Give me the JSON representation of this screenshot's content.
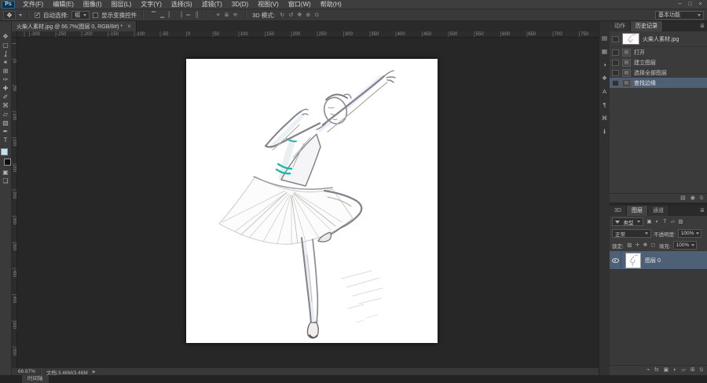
{
  "window": {
    "controls": [
      "─",
      "□",
      "×"
    ]
  },
  "menu_bar": {
    "logo": "Ps",
    "items": [
      "文件(F)",
      "编辑(E)",
      "图像(I)",
      "图层(L)",
      "文字(Y)",
      "选择(S)",
      "滤镜(T)",
      "3D(D)",
      "视图(V)",
      "窗口(W)",
      "帮助(H)"
    ]
  },
  "options_bar": {
    "tool_glyph": "✥",
    "auto_select_label": "自动选择:",
    "auto_select_value": "组",
    "transform_label": "显示变换控件",
    "mode_3d_label": "3D 模式:",
    "align_icons": [
      "▔",
      "▁",
      "▏",
      "▕",
      "═",
      "║"
    ],
    "distribute_icons": [
      "≡",
      "≣",
      "≋"
    ],
    "mode_3d_icons": [
      "↻",
      "↺",
      "✥",
      "⊕",
      "⊙"
    ],
    "workspace": "基本功能"
  },
  "document_tab": {
    "title": "火柴人素材.jpg @ 66.7%(图层 0, RGB/8#) *",
    "close": "×"
  },
  "rulers": {
    "h_labels": [
      "-300",
      "-250",
      "-200",
      "-150",
      "-100",
      "-50",
      "0",
      "50",
      "100",
      "150",
      "200",
      "250",
      "300",
      "350",
      "400",
      "450",
      "500",
      "550",
      "600",
      "650",
      "700",
      "750"
    ],
    "v_labels": [
      "0",
      "50",
      "100",
      "150",
      "200",
      "250",
      "300",
      "350",
      "400",
      "450",
      "500",
      "550"
    ]
  },
  "toolbox": {
    "tools": [
      {
        "n": "move-tool-icon",
        "g": "✥"
      },
      {
        "n": "marquee-tool-icon",
        "g": "▢"
      },
      {
        "n": "lasso-tool-icon",
        "g": "ʆ"
      },
      {
        "n": "quick-selection-tool-icon",
        "g": "✶"
      },
      {
        "n": "crop-tool-icon",
        "g": "⊞"
      },
      {
        "n": "eyedropper-tool-icon",
        "g": "✑"
      },
      {
        "n": "healing-brush-tool-icon",
        "g": "✚"
      },
      {
        "n": "brush-tool-icon",
        "g": "✐"
      },
      {
        "n": "clone-stamp-tool-icon",
        "g": "⌘"
      },
      {
        "n": "eraser-tool-icon",
        "g": "▱"
      },
      {
        "n": "gradient-tool-icon",
        "g": "▨"
      },
      {
        "n": "pen-tool-icon",
        "g": "✒"
      },
      {
        "n": "type-tool-icon",
        "g": "T"
      }
    ],
    "below_swatch_tools": [
      {
        "n": "quick-mask-icon",
        "g": "▣"
      },
      {
        "n": "screen-mode-icon",
        "g": "❏"
      }
    ],
    "foreground_color": "#bfe2f0",
    "background_color": "#0e0e0e"
  },
  "side_strip": [
    {
      "n": "color-panel-icon",
      "g": "▤"
    },
    {
      "n": "swatches-panel-icon",
      "g": "▦"
    },
    {
      "n": "adjustments-panel-icon",
      "g": "◑"
    },
    {
      "n": "styles-panel-icon",
      "g": "❖"
    },
    {
      "n": "character-panel-icon",
      "g": "A"
    },
    {
      "n": "paragraph-panel-icon",
      "g": "¶"
    },
    {
      "n": "clone-source-panel-icon",
      "g": "⌘"
    },
    {
      "n": "info-panel-icon",
      "g": "ℹ"
    }
  ],
  "history_panel": {
    "tabs": [
      {
        "label": "动作",
        "active": false
      },
      {
        "label": "历史记录",
        "active": true
      }
    ],
    "menu_icon": "≣",
    "snapshot_name": "火柴人素材.jpg",
    "steps": [
      {
        "label": "打开",
        "selected": false
      },
      {
        "label": "建立图层",
        "selected": false
      },
      {
        "label": "选择全部图层",
        "selected": false
      },
      {
        "label": "查找边缘",
        "selected": true
      }
    ],
    "step_icon": "▤",
    "footer_icons": [
      {
        "n": "new-doc-from-state-icon",
        "g": "▤"
      },
      {
        "n": "new-snapshot-icon",
        "g": "◉"
      },
      {
        "n": "delete-state-icon",
        "g": "⍉"
      }
    ]
  },
  "layers_panel": {
    "tabs": [
      {
        "label": "3D",
        "active": false
      },
      {
        "label": "图层",
        "active": true
      },
      {
        "label": "通道",
        "active": false
      }
    ],
    "menu_icon": "≣",
    "filter_label": "类型",
    "filter_icons": [
      {
        "n": "filter-pixel-layers-icon",
        "g": "▣"
      },
      {
        "n": "filter-adjustment-layers-icon",
        "g": "◐"
      },
      {
        "n": "filter-type-layers-icon",
        "g": "T"
      },
      {
        "n": "filter-shape-layers-icon",
        "g": "▱"
      },
      {
        "n": "filter-smart-objects-icon",
        "g": "▨"
      }
    ],
    "blend_mode": "正常",
    "opacity_label": "不透明度:",
    "opacity_value": "100%",
    "lock_label": "锁定:",
    "lock_icons": [
      {
        "n": "lock-transparency-icon",
        "g": "▨"
      },
      {
        "n": "lock-pixels-icon",
        "g": "✛"
      },
      {
        "n": "lock-position-icon",
        "g": "✥"
      },
      {
        "n": "lock-all-icon",
        "g": "◻"
      }
    ],
    "fill_label": "填充:",
    "fill_value": "100%",
    "layer": {
      "name": "图层 0",
      "visible": true
    },
    "footer_icons": [
      {
        "n": "link-layers-icon",
        "g": "⌁"
      },
      {
        "n": "layer-style-icon",
        "g": "fx"
      },
      {
        "n": "add-mask-icon",
        "g": "▣"
      },
      {
        "n": "adjustment-layer-icon",
        "g": "◐"
      },
      {
        "n": "new-group-icon",
        "g": "▱"
      },
      {
        "n": "new-layer-icon",
        "g": "⊞"
      },
      {
        "n": "delete-layer-icon",
        "g": "⍉"
      }
    ]
  },
  "status_bar": {
    "zoom": "66.67%",
    "doc_info": "文档:3.46M/3.46M"
  },
  "timeline": {
    "tab_label": "时间轴"
  }
}
